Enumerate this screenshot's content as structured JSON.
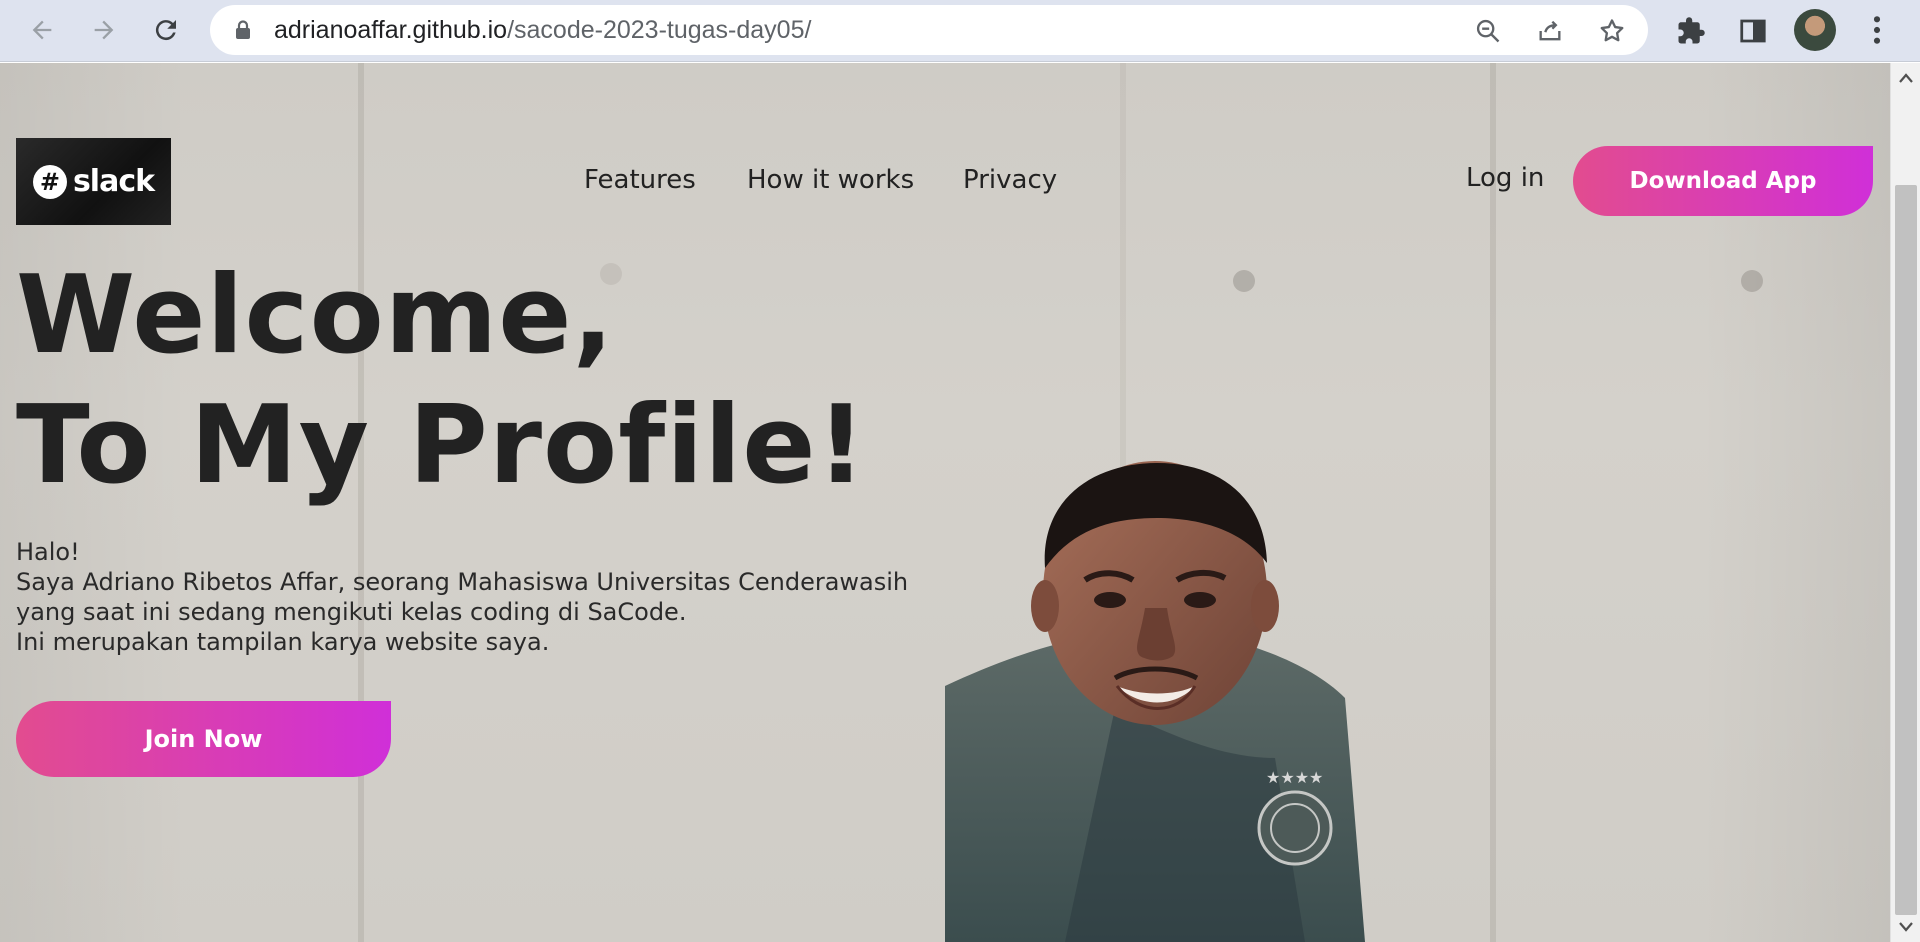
{
  "browser": {
    "url_host": "adrianoaffar.github.io",
    "url_path": "/sacode-2023-tugas-day05/"
  },
  "site": {
    "logo_text": "slack",
    "nav": [
      "Features",
      "How it works",
      "Privacy"
    ],
    "login_label": "Log in",
    "download_label": "Download App",
    "headline_1": "Welcome,",
    "headline_2": "To My Profile!",
    "intro": [
      "Halo!",
      "Saya Adriano Ribetos Affar, seorang Mahasiswa Universitas Cenderawasih",
      "yang saat ini sedang mengikuti kelas coding di SaCode.",
      "Ini merupakan tampilan karya website saya."
    ],
    "join_label": "Join Now"
  },
  "colors": {
    "button_gradient_start": "#e24c8f",
    "button_gradient_end": "#d02fd8",
    "text": "#222222"
  }
}
